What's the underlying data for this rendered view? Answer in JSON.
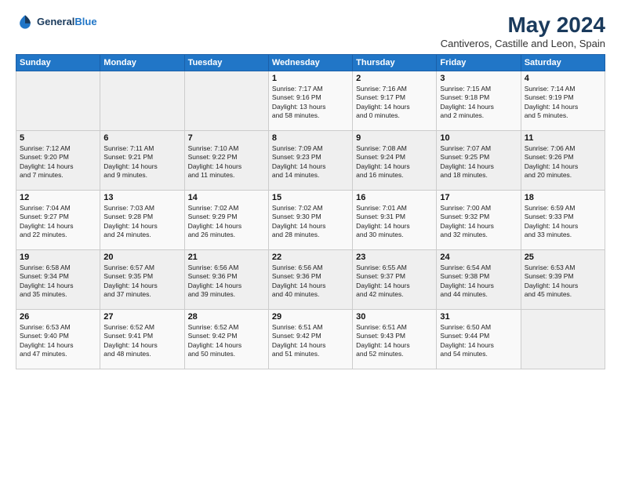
{
  "header": {
    "logo_line1": "General",
    "logo_line2": "Blue",
    "title": "May 2024",
    "subtitle": "Cantiveros, Castille and Leon, Spain"
  },
  "weekdays": [
    "Sunday",
    "Monday",
    "Tuesday",
    "Wednesday",
    "Thursday",
    "Friday",
    "Saturday"
  ],
  "weeks": [
    [
      {
        "day": "",
        "info": ""
      },
      {
        "day": "",
        "info": ""
      },
      {
        "day": "",
        "info": ""
      },
      {
        "day": "1",
        "info": "Sunrise: 7:17 AM\nSunset: 9:16 PM\nDaylight: 13 hours\nand 58 minutes."
      },
      {
        "day": "2",
        "info": "Sunrise: 7:16 AM\nSunset: 9:17 PM\nDaylight: 14 hours\nand 0 minutes."
      },
      {
        "day": "3",
        "info": "Sunrise: 7:15 AM\nSunset: 9:18 PM\nDaylight: 14 hours\nand 2 minutes."
      },
      {
        "day": "4",
        "info": "Sunrise: 7:14 AM\nSunset: 9:19 PM\nDaylight: 14 hours\nand 5 minutes."
      }
    ],
    [
      {
        "day": "5",
        "info": "Sunrise: 7:12 AM\nSunset: 9:20 PM\nDaylight: 14 hours\nand 7 minutes."
      },
      {
        "day": "6",
        "info": "Sunrise: 7:11 AM\nSunset: 9:21 PM\nDaylight: 14 hours\nand 9 minutes."
      },
      {
        "day": "7",
        "info": "Sunrise: 7:10 AM\nSunset: 9:22 PM\nDaylight: 14 hours\nand 11 minutes."
      },
      {
        "day": "8",
        "info": "Sunrise: 7:09 AM\nSunset: 9:23 PM\nDaylight: 14 hours\nand 14 minutes."
      },
      {
        "day": "9",
        "info": "Sunrise: 7:08 AM\nSunset: 9:24 PM\nDaylight: 14 hours\nand 16 minutes."
      },
      {
        "day": "10",
        "info": "Sunrise: 7:07 AM\nSunset: 9:25 PM\nDaylight: 14 hours\nand 18 minutes."
      },
      {
        "day": "11",
        "info": "Sunrise: 7:06 AM\nSunset: 9:26 PM\nDaylight: 14 hours\nand 20 minutes."
      }
    ],
    [
      {
        "day": "12",
        "info": "Sunrise: 7:04 AM\nSunset: 9:27 PM\nDaylight: 14 hours\nand 22 minutes."
      },
      {
        "day": "13",
        "info": "Sunrise: 7:03 AM\nSunset: 9:28 PM\nDaylight: 14 hours\nand 24 minutes."
      },
      {
        "day": "14",
        "info": "Sunrise: 7:02 AM\nSunset: 9:29 PM\nDaylight: 14 hours\nand 26 minutes."
      },
      {
        "day": "15",
        "info": "Sunrise: 7:02 AM\nSunset: 9:30 PM\nDaylight: 14 hours\nand 28 minutes."
      },
      {
        "day": "16",
        "info": "Sunrise: 7:01 AM\nSunset: 9:31 PM\nDaylight: 14 hours\nand 30 minutes."
      },
      {
        "day": "17",
        "info": "Sunrise: 7:00 AM\nSunset: 9:32 PM\nDaylight: 14 hours\nand 32 minutes."
      },
      {
        "day": "18",
        "info": "Sunrise: 6:59 AM\nSunset: 9:33 PM\nDaylight: 14 hours\nand 33 minutes."
      }
    ],
    [
      {
        "day": "19",
        "info": "Sunrise: 6:58 AM\nSunset: 9:34 PM\nDaylight: 14 hours\nand 35 minutes."
      },
      {
        "day": "20",
        "info": "Sunrise: 6:57 AM\nSunset: 9:35 PM\nDaylight: 14 hours\nand 37 minutes."
      },
      {
        "day": "21",
        "info": "Sunrise: 6:56 AM\nSunset: 9:36 PM\nDaylight: 14 hours\nand 39 minutes."
      },
      {
        "day": "22",
        "info": "Sunrise: 6:56 AM\nSunset: 9:36 PM\nDaylight: 14 hours\nand 40 minutes."
      },
      {
        "day": "23",
        "info": "Sunrise: 6:55 AM\nSunset: 9:37 PM\nDaylight: 14 hours\nand 42 minutes."
      },
      {
        "day": "24",
        "info": "Sunrise: 6:54 AM\nSunset: 9:38 PM\nDaylight: 14 hours\nand 44 minutes."
      },
      {
        "day": "25",
        "info": "Sunrise: 6:53 AM\nSunset: 9:39 PM\nDaylight: 14 hours\nand 45 minutes."
      }
    ],
    [
      {
        "day": "26",
        "info": "Sunrise: 6:53 AM\nSunset: 9:40 PM\nDaylight: 14 hours\nand 47 minutes."
      },
      {
        "day": "27",
        "info": "Sunrise: 6:52 AM\nSunset: 9:41 PM\nDaylight: 14 hours\nand 48 minutes."
      },
      {
        "day": "28",
        "info": "Sunrise: 6:52 AM\nSunset: 9:42 PM\nDaylight: 14 hours\nand 50 minutes."
      },
      {
        "day": "29",
        "info": "Sunrise: 6:51 AM\nSunset: 9:42 PM\nDaylight: 14 hours\nand 51 minutes."
      },
      {
        "day": "30",
        "info": "Sunrise: 6:51 AM\nSunset: 9:43 PM\nDaylight: 14 hours\nand 52 minutes."
      },
      {
        "day": "31",
        "info": "Sunrise: 6:50 AM\nSunset: 9:44 PM\nDaylight: 14 hours\nand 54 minutes."
      },
      {
        "day": "",
        "info": ""
      }
    ]
  ]
}
